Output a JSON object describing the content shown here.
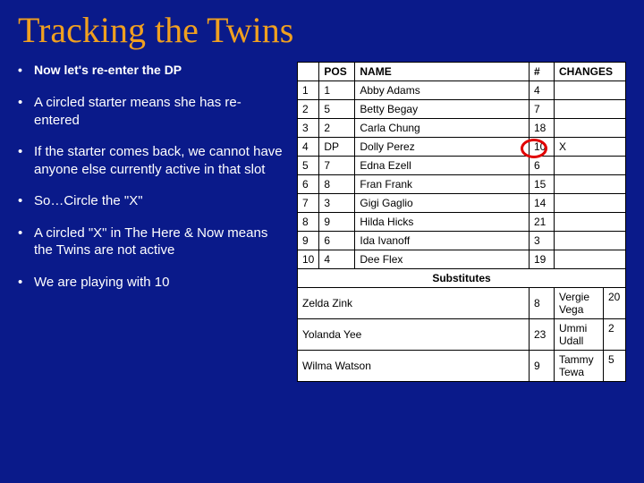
{
  "title": "Tracking the Twins",
  "bullets": [
    "Now let's re-enter the DP",
    "A circled starter means she has re-entered",
    "If the starter comes back, we cannot have anyone else currently active in that slot",
    "So…Circle the \"X\"",
    "A circled \"X\" in The Here & Now means the Twins are not active",
    "We are playing with 10"
  ],
  "headers": {
    "col0": "",
    "pos": "POS",
    "name": "NAME",
    "num": "#",
    "changes": "CHANGES"
  },
  "rows": [
    {
      "n": "1",
      "pos": "1",
      "name": "Abby Adams",
      "num": "4",
      "ch": ""
    },
    {
      "n": "2",
      "pos": "5",
      "name": "Betty Begay",
      "num": "7",
      "ch": ""
    },
    {
      "n": "3",
      "pos": "2",
      "name": "Carla Chung",
      "num": "18",
      "ch": ""
    },
    {
      "n": "4",
      "pos": "DP",
      "name": "Dolly Perez",
      "num": "10",
      "ch": "X"
    },
    {
      "n": "5",
      "pos": "7",
      "name": "Edna Ezell",
      "num": "6",
      "ch": ""
    },
    {
      "n": "6",
      "pos": "8",
      "name": "Fran Frank",
      "num": "15",
      "ch": ""
    },
    {
      "n": "7",
      "pos": "3",
      "name": "Gigi Gaglio",
      "num": "14",
      "ch": ""
    },
    {
      "n": "8",
      "pos": "9",
      "name": "Hilda Hicks",
      "num": "21",
      "ch": ""
    },
    {
      "n": "9",
      "pos": "6",
      "name": "Ida Ivanoff",
      "num": "3",
      "ch": ""
    },
    {
      "n": "10",
      "pos": "4",
      "name": "Dee Flex",
      "num": "19",
      "ch": ""
    }
  ],
  "subs_header": "Substitutes",
  "subs": [
    {
      "a": "Zelda Zink",
      "an": "8",
      "b": "Vergie Vega",
      "bn": "20"
    },
    {
      "a": "Yolanda Yee",
      "an": "23",
      "b": "Ummi Udall",
      "bn": "2"
    },
    {
      "a": "Wilma Watson",
      "an": "9",
      "b": "Tammy Tewa",
      "bn": "5"
    }
  ]
}
